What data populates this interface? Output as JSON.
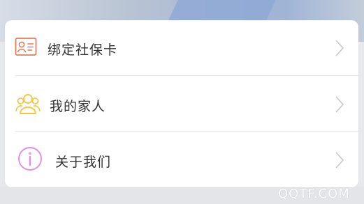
{
  "menu": {
    "items": [
      {
        "label": "绑定社保卡",
        "icon": "id-card-icon",
        "color": "#e57c5a"
      },
      {
        "label": "我的家人",
        "icon": "family-icon",
        "color": "#f2c740"
      },
      {
        "label": "关于我们",
        "icon": "info-icon",
        "color": "#e48be6"
      }
    ]
  },
  "watermark": "QQTF.COM"
}
